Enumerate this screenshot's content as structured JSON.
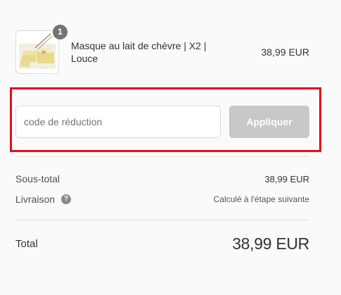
{
  "line_item": {
    "image_alt": "Masque au lait de chèvre",
    "quantity": "1",
    "name": "Masque au lait de chèvre | X2 | Louce",
    "price": "38,99 EUR"
  },
  "discount": {
    "placeholder": "code de réduction",
    "value": "",
    "apply_label": "Appliquer"
  },
  "summary": {
    "subtotal_label": "Sous-total",
    "subtotal_value": "38,99 EUR",
    "shipping_label": "Livraison",
    "shipping_help_icon": "?",
    "shipping_value": "Calculé à l'étape suivante",
    "total_label": "Total",
    "total_value": "38,99 EUR"
  },
  "colors": {
    "highlight": "#e40d1d",
    "apply_button_disabled": "#c8c8c8",
    "quantity_badge": "#737373"
  }
}
